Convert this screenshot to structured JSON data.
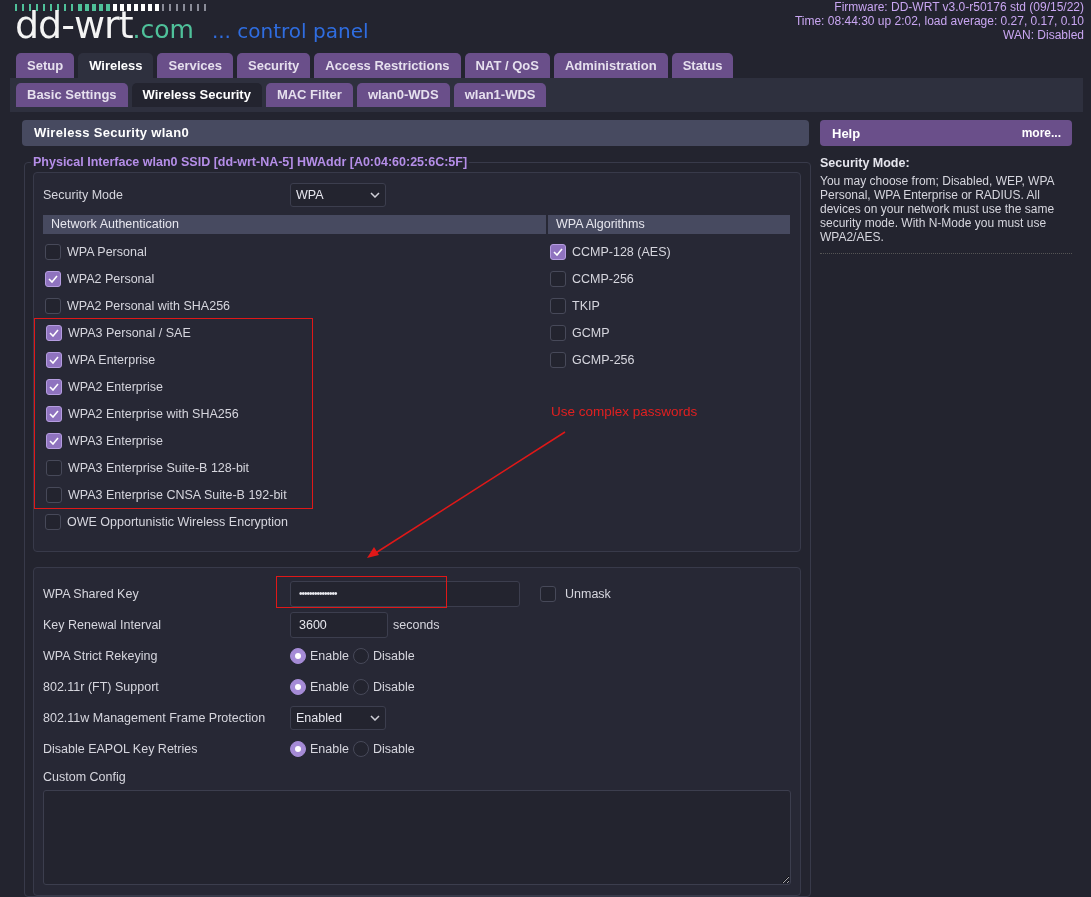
{
  "header": {
    "logo": {
      "name": "dd-wrt",
      "domain": ".com",
      "tagline": "... control panel"
    },
    "info": [
      "Firmware: DD-WRT v3.0-r50176 std (09/15/22)",
      "Time: 08:44:30 up 2:02, load average: 0.27, 0.17, 0.10",
      "WAN: Disabled"
    ]
  },
  "tabs": [
    {
      "label": "Setup",
      "selected": false
    },
    {
      "label": "Wireless",
      "selected": true
    },
    {
      "label": "Services",
      "selected": false
    },
    {
      "label": "Security",
      "selected": false
    },
    {
      "label": "Access Restrictions",
      "selected": false
    },
    {
      "label": "NAT / QoS",
      "selected": false
    },
    {
      "label": "Administration",
      "selected": false
    },
    {
      "label": "Status",
      "selected": false
    }
  ],
  "subtabs": [
    {
      "label": "Basic Settings",
      "selected": false
    },
    {
      "label": "Wireless Security",
      "selected": true
    },
    {
      "label": "MAC Filter",
      "selected": false
    },
    {
      "label": "wlan0-WDS",
      "selected": false
    },
    {
      "label": "wlan1-WDS",
      "selected": false
    }
  ],
  "panel": {
    "title": "Wireless Security wlan0",
    "legend": "Physical Interface wlan0 SSID [dd-wrt-NA-5] HWAddr [A0:04:60:25:6C:5F]",
    "security_mode": {
      "label": "Security Mode",
      "value": "WPA"
    },
    "auth": {
      "heading": "Network Authentication",
      "groups": [
        {
          "highlighted": false,
          "items": [
            {
              "label": "WPA Personal",
              "checked": false
            },
            {
              "label": "WPA2 Personal",
              "checked": true
            },
            {
              "label": "WPA2 Personal with SHA256",
              "checked": false
            }
          ]
        },
        {
          "highlighted": true,
          "items": [
            {
              "label": "WPA3 Personal / SAE",
              "checked": true
            },
            {
              "label": "WPA Enterprise",
              "checked": true
            },
            {
              "label": "WPA2 Enterprise",
              "checked": true
            },
            {
              "label": "WPA2 Enterprise with SHA256",
              "checked": true
            },
            {
              "label": "WPA3 Enterprise",
              "checked": true
            },
            {
              "label": "WPA3 Enterprise Suite-B 128-bit",
              "checked": false
            },
            {
              "label": "WPA3 Enterprise CNSA Suite-B 192-bit",
              "checked": false
            }
          ]
        },
        {
          "highlighted": false,
          "items": [
            {
              "label": "OWE Opportunistic Wireless Encryption",
              "checked": false
            }
          ]
        }
      ]
    },
    "algorithms": {
      "heading": "WPA Algorithms",
      "items": [
        {
          "label": "CCMP-128 (AES)",
          "checked": true
        },
        {
          "label": "CCMP-256",
          "checked": false
        },
        {
          "label": "TKIP",
          "checked": false
        },
        {
          "label": "GCMP",
          "checked": false
        },
        {
          "label": "GCMP-256",
          "checked": false
        }
      ]
    },
    "settings": [
      {
        "kind": "password",
        "label": "WPA Shared Key",
        "value": "•••••••••••••••",
        "highlighted": true,
        "unmask": {
          "label": "Unmask",
          "checked": false
        }
      },
      {
        "kind": "text",
        "label": "Key Renewal Interval",
        "value": "3600",
        "unit": "seconds"
      },
      {
        "kind": "radio",
        "label": "WPA Strict Rekeying",
        "options": [
          {
            "label": "Enable",
            "selected": true
          },
          {
            "label": "Disable",
            "selected": false
          }
        ]
      },
      {
        "kind": "radio",
        "label": "802.11r (FT) Support",
        "options": [
          {
            "label": "Enable",
            "selected": true
          },
          {
            "label": "Disable",
            "selected": false
          }
        ]
      },
      {
        "kind": "select",
        "label": "802.11w Management Frame Protection",
        "value": "Enabled"
      },
      {
        "kind": "radio",
        "label": "Disable EAPOL Key Retries",
        "options": [
          {
            "label": "Enable",
            "selected": true
          },
          {
            "label": "Disable",
            "selected": false
          }
        ]
      },
      {
        "kind": "textarea",
        "label": "Custom Config"
      }
    ]
  },
  "annotation": {
    "note": "Use complex passwords"
  },
  "help": {
    "title": "Help",
    "more": "more...",
    "heading": "Security Mode:",
    "text": "You may choose from; Disabled, WEP, WPA Personal, WPA Enterprise or RADIUS. All devices on your network must use the same security mode. With N-Mode you must use WPA2/AES."
  }
}
